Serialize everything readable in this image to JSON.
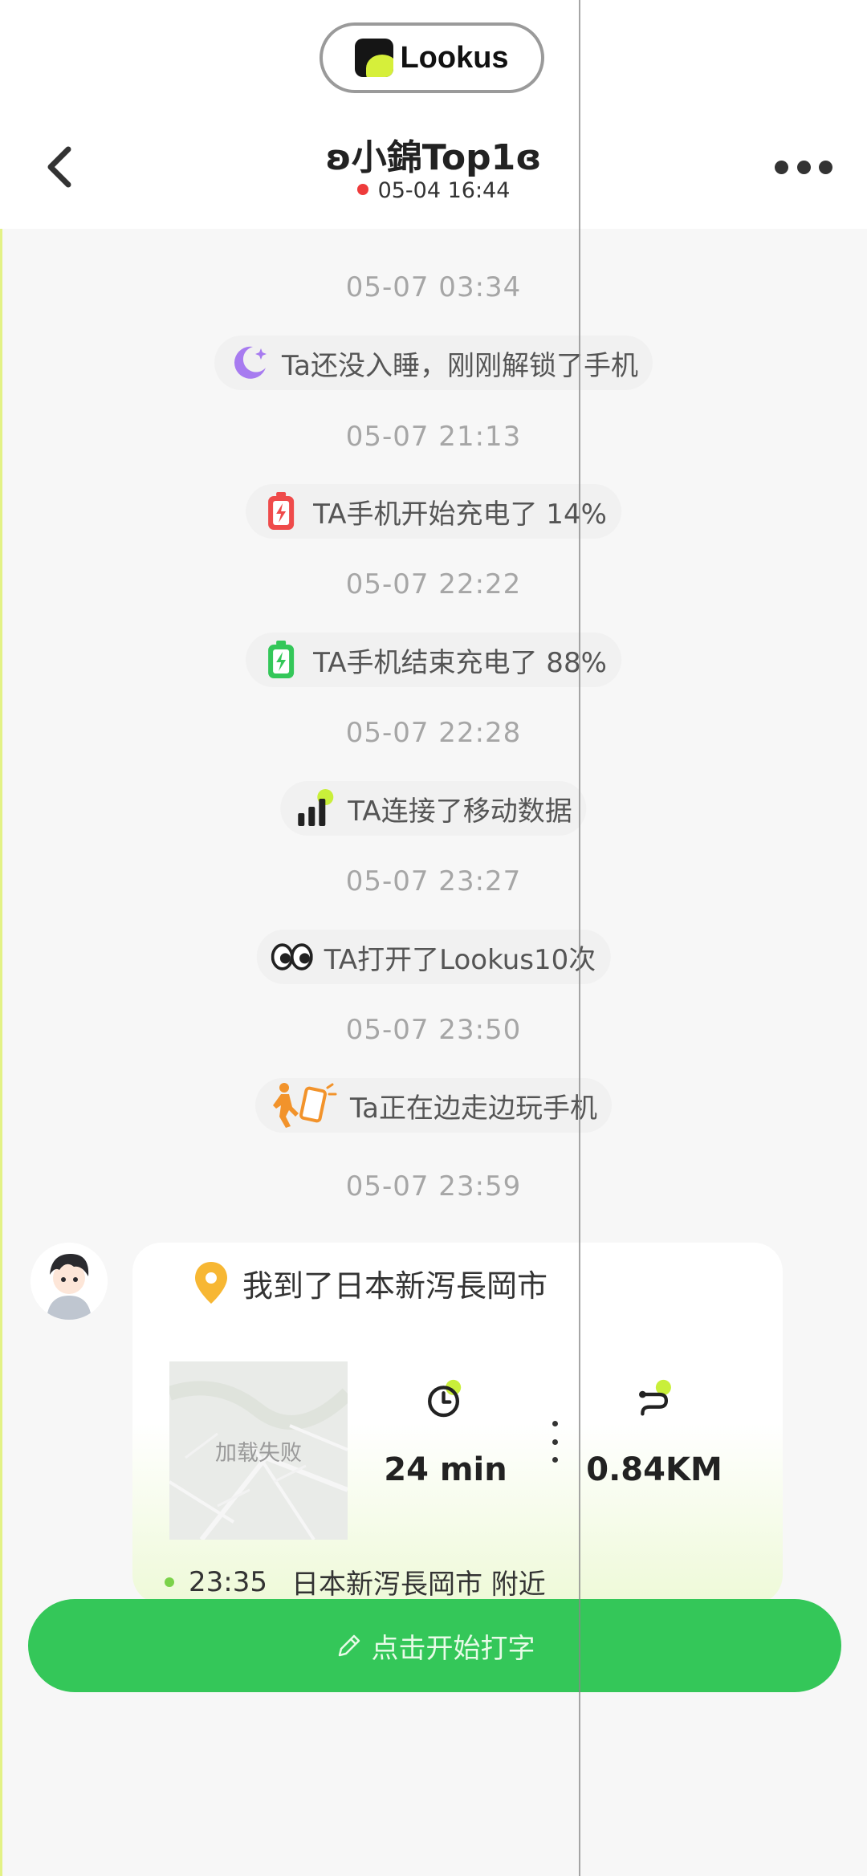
{
  "header": {
    "logo_text": "Lookus",
    "title": "ʚ小錦Top1ɞ",
    "status_time": "05-04 16:44",
    "status_color": "#ee3b3b"
  },
  "events": [
    {
      "time": "05-07 03:34",
      "icon": "moon-icon",
      "text": "Ta还没入睡，刚刚解锁了手机"
    },
    {
      "time": "05-07 21:13",
      "icon": "battery-charging-red-icon",
      "text": "TA手机开始充电了 14%"
    },
    {
      "time": "05-07 22:22",
      "icon": "battery-charging-green-icon",
      "text": "TA手机结束充电了 88%"
    },
    {
      "time": "05-07 22:28",
      "icon": "signal-bars-icon",
      "text": "TA连接了移动数据"
    },
    {
      "time": "05-07 23:27",
      "icon": "eyes-icon",
      "text": "TA打开了Lookus10次"
    },
    {
      "time": "05-07 23:50",
      "icon": "walking-phone-icon",
      "text": "Ta正在边走边玩手机"
    }
  ],
  "last_time": "05-07 23:59",
  "location_card": {
    "title": "我到了日本新泻長岡市",
    "map_status": "加载失败",
    "duration": "24 min",
    "distance": "0.84KM",
    "trace_time": "23:35",
    "trace_place": "日本新泻長岡市 附近"
  },
  "input": {
    "placeholder": "点击开始打字"
  },
  "colors": {
    "accent_green": "#34c759",
    "lime": "#d6ef3a",
    "text_gray": "#a6a6a6"
  }
}
